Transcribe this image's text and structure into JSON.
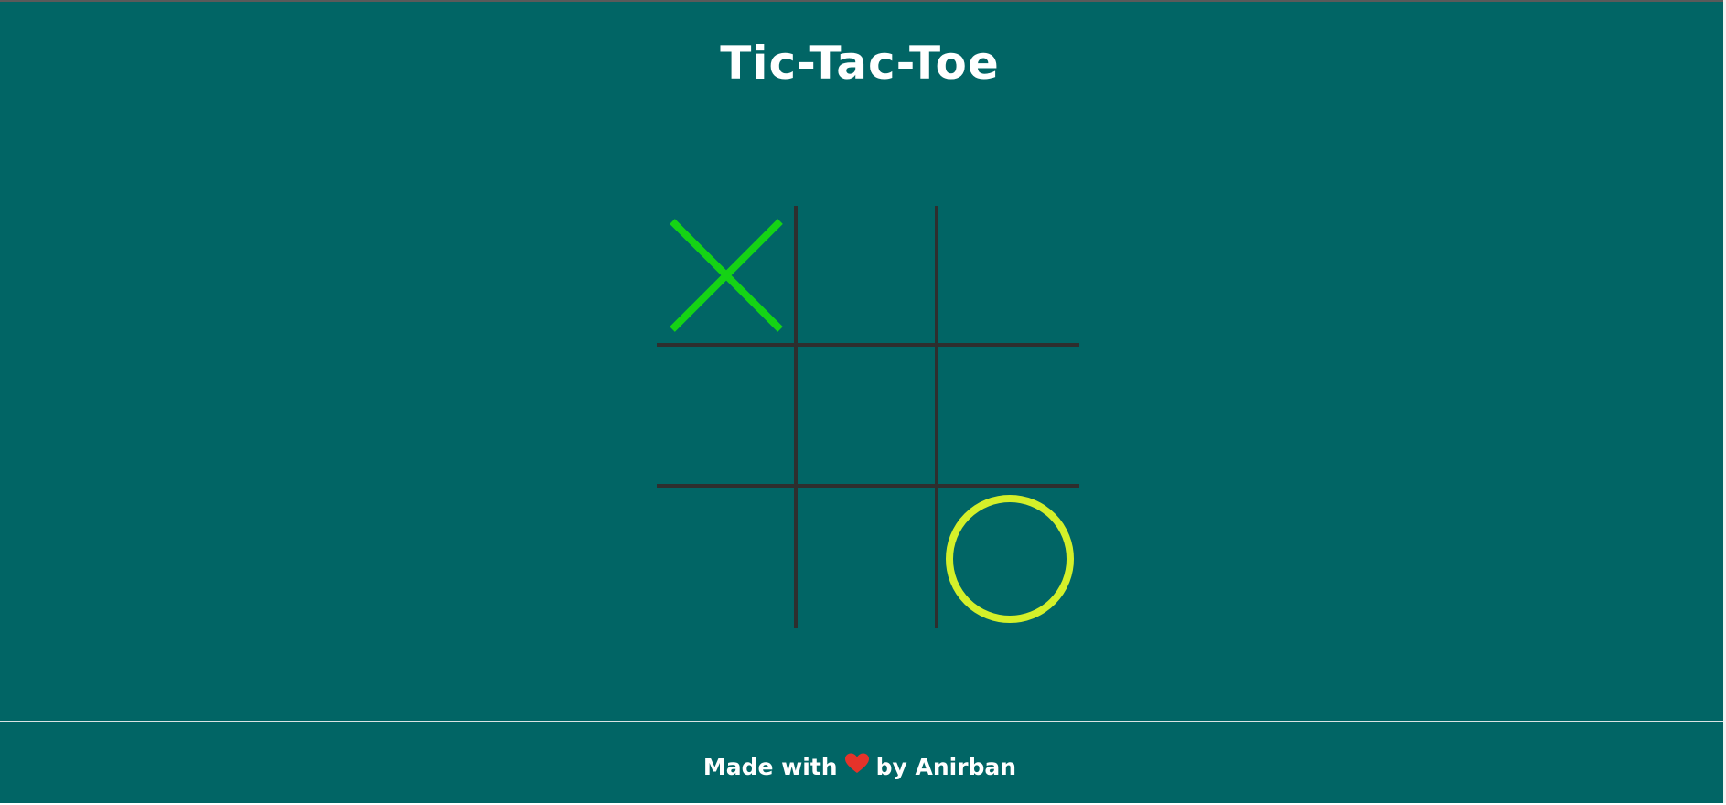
{
  "title": "Tic-Tac-Toe",
  "board": {
    "cells": [
      "X",
      "",
      "",
      "",
      "",
      "",
      "",
      "",
      "O"
    ]
  },
  "colors": {
    "background": "#016565",
    "grid": "#2e2e2e",
    "x_mark": "#15d315",
    "o_mark": "#d4f02a",
    "heart": "#e5332a"
  },
  "footer": {
    "prefix": "Made with",
    "icon": "heart-icon",
    "suffix": "by Anirban"
  }
}
